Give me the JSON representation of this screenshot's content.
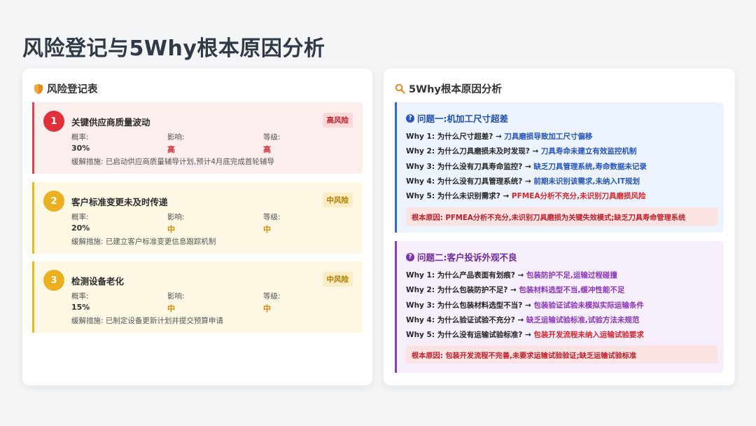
{
  "page_title": "风险登记与5Why根本原因分析",
  "colors": {
    "high": "#e0303a",
    "medium": "#eab020",
    "blue_accent": "#3468d6",
    "purple_accent": "#8a3fbd"
  },
  "risk_panel": {
    "title": "风险登记表",
    "icon": "shield-icon",
    "fields": {
      "probability": "概率:",
      "impact": "影响:",
      "level": "等级:"
    },
    "items": [
      {
        "num": "1",
        "title": "关键供应商质量波动",
        "badge": "高风险",
        "severity": "high",
        "probability": "30%",
        "impact": "高",
        "level": "高",
        "mitigation": "缓解措施: 已启动供应商质量辅导计划,预计4月底完成首轮辅导"
      },
      {
        "num": "2",
        "title": "客户标准变更未及时传递",
        "badge": "中风险",
        "severity": "medium",
        "probability": "20%",
        "impact": "中",
        "level": "中",
        "mitigation": "缓解措施: 已建立客户标准变更信息跟踪机制"
      },
      {
        "num": "3",
        "title": "检测设备老化",
        "badge": "中风险",
        "severity": "medium",
        "probability": "15%",
        "impact": "中",
        "level": "中",
        "mitigation": "缓解措施: 已制定设备更新计划并提交预算申请"
      }
    ]
  },
  "why_panel": {
    "title": "5Why根本原因分析",
    "icon": "magnifier-icon",
    "problems": [
      {
        "title": "问题一:机加工尺寸超差",
        "icon": "question-icon",
        "whys": [
          {
            "q": "Why 1: 为什么尺寸超差?",
            "a": "刀具磨损导致加工尺寸偏移"
          },
          {
            "q": "Why 2: 为什么刀具磨损未及时发现?",
            "a": "刀具寿命未建立有效监控机制"
          },
          {
            "q": "Why 3: 为什么没有刀具寿命监控?",
            "a": "缺乏刀具管理系统,寿命数据未记录"
          },
          {
            "q": "Why 4: 为什么没有刀具管理系统?",
            "a": "前期未识别该需求,未纳入IT规划"
          },
          {
            "q": "Why 5: 为什么未识别需求?",
            "a": "PFMEA分析不充分,未识别刀具磨损风险"
          }
        ],
        "root_cause": "根本原因: PFMEA分析不充分,未识别刀具磨损为关键失效模式;缺乏刀具寿命管理系统"
      },
      {
        "title": "问题二:客户投诉外观不良",
        "icon": "question-icon",
        "whys": [
          {
            "q": "Why 1: 为什么产品表面有划痕?",
            "a": "包装防护不足,运输过程碰撞"
          },
          {
            "q": "Why 2: 为什么包装防护不足?",
            "a": "包装材料选型不当,缓冲性能不足"
          },
          {
            "q": "Why 3: 为什么包装材料选型不当?",
            "a": "包装验证试验未模拟实际运输条件"
          },
          {
            "q": "Why 4: 为什么验证试验不充分?",
            "a": "缺乏运输试验标准,试验方法未规范"
          },
          {
            "q": "Why 5: 为什么没有运输试验标准?",
            "a": "包装开发流程未纳入运输试验要求"
          }
        ],
        "root_cause": "根本原因: 包装开发流程不完善,未要求运输试验验证;缺乏运输试验标准"
      }
    ]
  }
}
